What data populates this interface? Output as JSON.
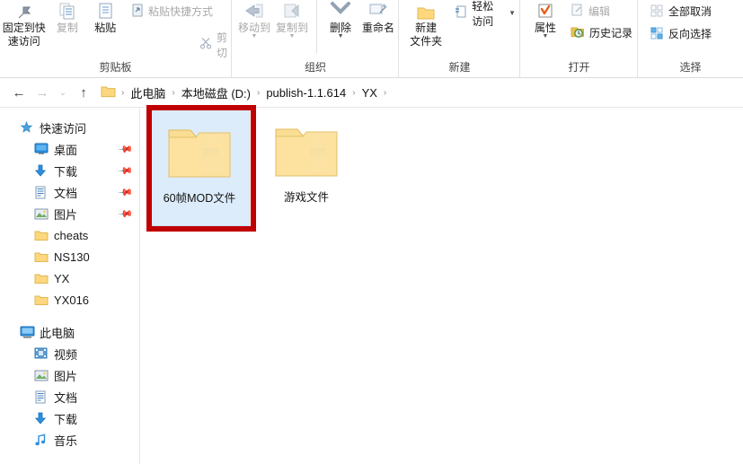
{
  "window": {
    "title": "YX"
  },
  "ribbon": {
    "groups": [
      {
        "name": "clipboard",
        "label": "剪贴板",
        "big_buttons": [
          {
            "label": "固定到快速访问",
            "icon": "pin-icon",
            "enabled": true
          },
          {
            "label": "复制",
            "icon": "copy-icon",
            "enabled": false
          },
          {
            "label": "粘贴",
            "icon": "paste-icon",
            "enabled": true
          }
        ],
        "small_buttons": [
          {
            "label": "粘贴快捷方式",
            "icon": "paste-shortcut-icon",
            "enabled": false
          },
          {
            "label": "剪切",
            "icon": "scissors-icon",
            "enabled": false
          }
        ]
      },
      {
        "name": "organize",
        "label": "组织",
        "big_buttons": [
          {
            "label": "移动到",
            "icon": "move-to-icon",
            "enabled": false,
            "caret": true
          },
          {
            "label": "复制到",
            "icon": "copy-to-icon",
            "enabled": false,
            "caret": true
          },
          {
            "label": "删除",
            "icon": "delete-icon",
            "enabled": true,
            "caret": true
          },
          {
            "label": "重命名",
            "icon": "rename-icon",
            "enabled": true
          }
        ]
      },
      {
        "name": "new",
        "label": "新建",
        "big_buttons": [
          {
            "label": "新建\n文件夹",
            "label_line1": "新建",
            "label_line2": "文件夹",
            "icon": "new-folder-icon",
            "enabled": true
          }
        ],
        "small_buttons": [
          {
            "label": "轻松访问",
            "icon": "easy-access-icon",
            "enabled": true,
            "caret": true
          }
        ]
      },
      {
        "name": "open",
        "label": "打开",
        "big_buttons": [
          {
            "label": "属性",
            "icon": "properties-icon",
            "enabled": true,
            "caret": true
          }
        ],
        "small_buttons": [
          {
            "label": "编辑",
            "icon": "edit-icon",
            "enabled": false
          },
          {
            "label": "历史记录",
            "icon": "history-icon",
            "enabled": true
          }
        ]
      },
      {
        "name": "select",
        "label": "选择",
        "small_buttons": [
          {
            "label": "全部取消",
            "icon": "deselect-all-icon",
            "enabled": true
          },
          {
            "label": "反向选择",
            "icon": "invert-selection-icon",
            "enabled": true
          }
        ]
      }
    ]
  },
  "addressbar": {
    "back": "←",
    "forward": "→",
    "recent": "⌄",
    "up": "↑",
    "crumbs": [
      "此电脑",
      "本地磁盘 (D:)",
      "publish-1.1.614",
      "YX"
    ],
    "separator": "›"
  },
  "navpane": {
    "sections": [
      {
        "header": {
          "label": "快速访问",
          "icon": "star-pin-icon"
        },
        "items": [
          {
            "label": "桌面",
            "icon": "desktop-icon",
            "pinned": true
          },
          {
            "label": "下载",
            "icon": "download-icon",
            "pinned": true
          },
          {
            "label": "文档",
            "icon": "document-icon",
            "pinned": true
          },
          {
            "label": "图片",
            "icon": "pictures-icon",
            "pinned": true
          },
          {
            "label": "cheats",
            "icon": "folder-icon",
            "pinned": false
          },
          {
            "label": "NS130",
            "icon": "folder-icon",
            "pinned": false
          },
          {
            "label": "YX",
            "icon": "folder-icon",
            "pinned": false
          },
          {
            "label": "YX016",
            "icon": "folder-icon",
            "pinned": false
          }
        ]
      },
      {
        "header": {
          "label": "此电脑",
          "icon": "this-pc-icon"
        },
        "items": [
          {
            "label": "视频",
            "icon": "videos-icon",
            "pinned": false
          },
          {
            "label": "图片",
            "icon": "pictures-icon",
            "pinned": false
          },
          {
            "label": "文档",
            "icon": "document-icon",
            "pinned": false
          },
          {
            "label": "下载",
            "icon": "download-icon",
            "pinned": false
          },
          {
            "label": "音乐",
            "icon": "music-icon",
            "pinned": false
          }
        ]
      }
    ]
  },
  "content": {
    "items": [
      {
        "name": "60帧MOD文件",
        "type": "folder",
        "selected": true
      },
      {
        "name": "游戏文件",
        "type": "folder",
        "selected": false
      }
    ]
  },
  "annotation": {
    "color": "#c00000",
    "target": "60帧MOD文件"
  }
}
